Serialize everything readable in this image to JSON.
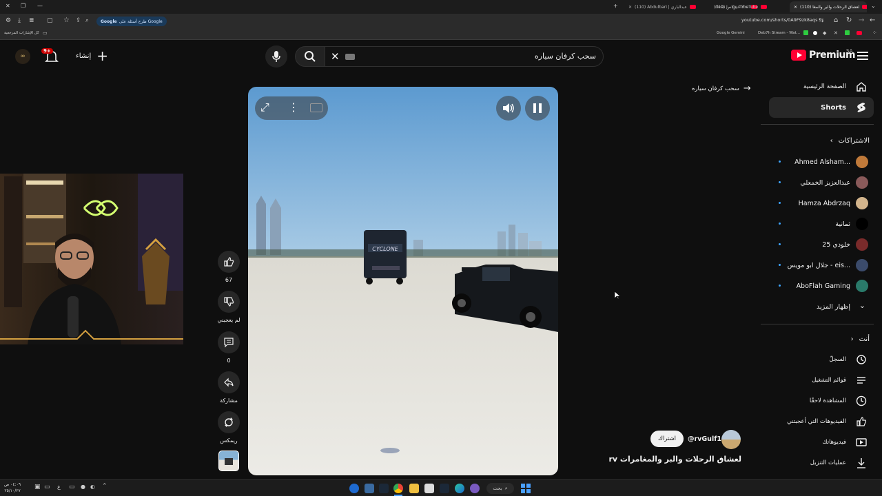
{
  "browser": {
    "tabs": [
      {
        "title": "(110) لعشاق الرحلات والبر والمغا"
      },
      {
        "title": "(110) يرياس - YouTube"
      },
      {
        "title": "(110) Abdulbari | عبدالباري"
      },
      {
        "title": "rless I - YouTube"
      }
    ],
    "url": "youtube.com/shorts/0A9F9zk8aqs",
    "google_button": "طرح أسئلة على Google",
    "bookmarks_right": [
      "Google Gemini",
      "Deb7h Stream - Wat..."
    ],
    "bookmarks_left": "كل الإشارات المرجعية"
  },
  "header": {
    "brand": "Premium",
    "region": "SA",
    "search_value": "سحب كرفان سياره",
    "create_label": "إنشاء",
    "notif_badge": "9+"
  },
  "back_link": "سحب كرفان سياره",
  "sidebar": {
    "home": "الصفحة الرئيسية",
    "shorts": "Shorts",
    "subs_title": "الاشتراكات",
    "subscriptions": [
      {
        "name": "Ahmed Alsham...",
        "color": "#c07a3a"
      },
      {
        "name": "عبدالعزيز الخمعلي",
        "color": "#8a5a5a"
      },
      {
        "name": "Hamza Abdrzaq",
        "color": "#d2b48c"
      },
      {
        "name": "ثمانية",
        "color": "#000000"
      },
      {
        "name": "خلودي 25",
        "color": "#7a2b2b"
      },
      {
        "name": "جلال ابو مويس - eis...",
        "color": "#3b4b6b"
      },
      {
        "name": "AboFlah Gaming",
        "color": "#2a7a6a"
      }
    ],
    "show_more": "إظهار المزيد",
    "you_title": "أنت",
    "you_items": [
      {
        "label": "السجلّ",
        "icon": "history-icon"
      },
      {
        "label": "قوائم التشغيل",
        "icon": "playlists-icon"
      },
      {
        "label": "المشاهدة لاحقًا",
        "icon": "watch-later-icon"
      },
      {
        "label": "الفيديوهات التي أعجبتني",
        "icon": "liked-icon"
      },
      {
        "label": "فيديوهاتك",
        "icon": "your-videos-icon"
      },
      {
        "label": "عمليات التنزيل",
        "icon": "downloads-icon"
      }
    ]
  },
  "actions": {
    "likes": "67",
    "dislike": "لم يعجبني",
    "comments": "0",
    "share": "مشاركة",
    "remix": "ريمكس"
  },
  "video": {
    "channel": "@rvGulf1",
    "subscribe": "اشتراك",
    "title": "لعشاق الرحلات والبر والمغامرات rv ...",
    "trailer_text": "CYCLONE"
  },
  "taskbar": {
    "search": "بحث",
    "lang": "ع",
    "time": "٠٤:٠٩ ص",
    "date": "٢٥/١٠/٢٧"
  },
  "colors": {
    "accent": "#ff0033",
    "link": "#3ea6ff",
    "bg": "#0f0f0f"
  }
}
